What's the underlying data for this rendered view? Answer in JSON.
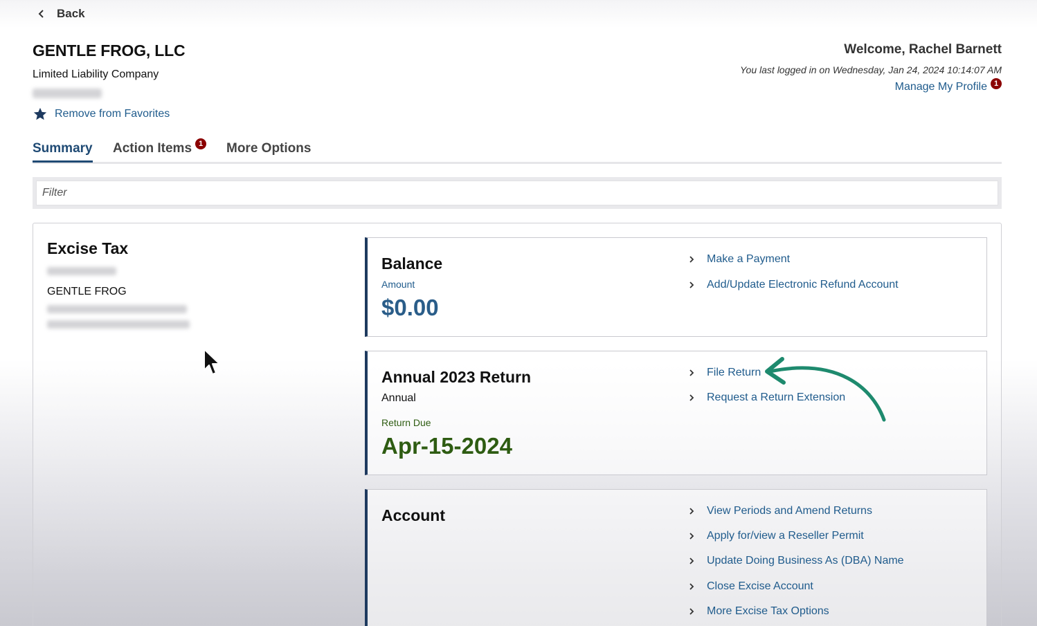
{
  "nav": {
    "back_label": "Back"
  },
  "business": {
    "name": "GENTLE FROG, LLC",
    "type": "Limited Liability Company",
    "favorites_label": "Remove from Favorites"
  },
  "user": {
    "welcome": "Welcome, Rachel Barnett",
    "last_login": "You last logged in on Wednesday, Jan 24, 2024 10:14:07 AM",
    "manage_profile": "Manage My Profile",
    "profile_badge": "1"
  },
  "tabs": [
    {
      "label": "Summary",
      "active": true
    },
    {
      "label": "Action Items",
      "badge": "1"
    },
    {
      "label": "More Options"
    }
  ],
  "filter": {
    "placeholder": "Filter"
  },
  "account": {
    "title": "Excise Tax",
    "name": "GENTLE FROG"
  },
  "balance": {
    "title": "Balance",
    "amount_label": "Amount",
    "amount": "$0.00",
    "actions": [
      "Make a Payment",
      "Add/Update Electronic Refund Account"
    ]
  },
  "return": {
    "title": "Annual 2023 Return",
    "frequency": "Annual",
    "due_label": "Return Due",
    "due_date": "Apr-15-2024",
    "actions": [
      "File Return",
      "Request a Return Extension"
    ]
  },
  "account_card": {
    "title": "Account",
    "actions": [
      "View Periods and Amend Returns",
      "Apply for/view a Reseller Permit",
      "Update Doing Business As (DBA) Name",
      "Close Excise Account",
      "More Excise Tax Options"
    ]
  },
  "colors": {
    "brand_navy": "#1e3a5f",
    "link": "#1f5b8c",
    "amount": "#2a5d89",
    "due_date": "#2e5c12",
    "badge": "#8b0000",
    "annotation_arrow": "#1e8a6e"
  }
}
